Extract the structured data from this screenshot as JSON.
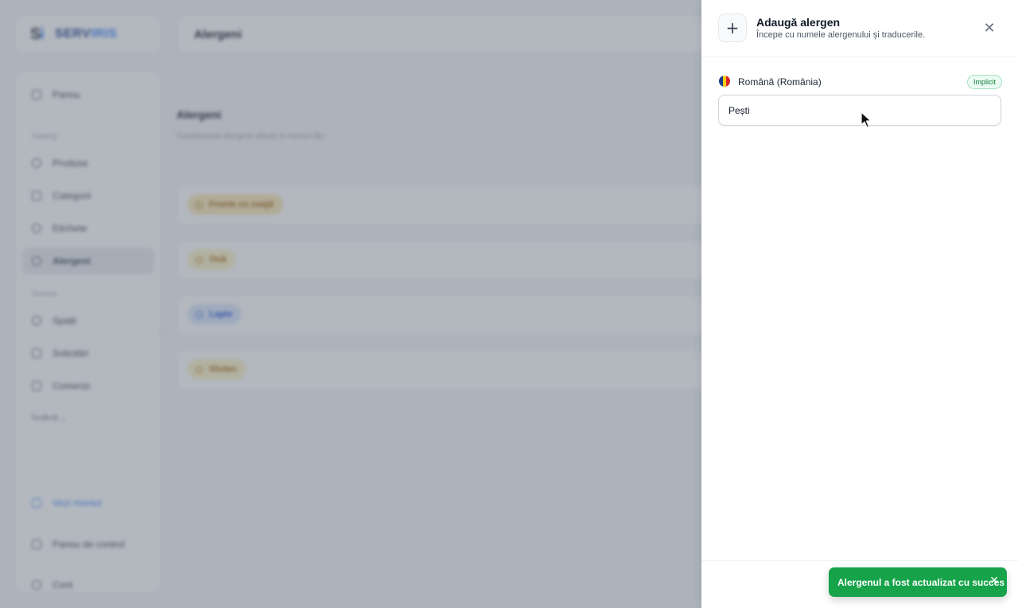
{
  "sidebar": {
    "logo_mark": "S",
    "logo_mark_accent": "i",
    "logo_text": "SERV",
    "logo_text_accent": "IRIS",
    "items": [
      {
        "label": "Panou",
        "icon": "grid-icon"
      },
      {
        "label": "Produse",
        "icon": "box-icon"
      },
      {
        "label": "Categorii",
        "icon": "grid-icon"
      },
      {
        "label": "Etichete",
        "icon": "tag-icon"
      },
      {
        "label": "Alergeni",
        "icon": "tag-icon"
      },
      {
        "label": "Spații",
        "icon": "pin-icon"
      },
      {
        "label": "Solicitări",
        "icon": "bell-icon"
      },
      {
        "label": "Comenzi",
        "icon": "receipt-icon"
      }
    ],
    "sections": {
      "catalog": "Catalog",
      "service": "Serviciu"
    },
    "more_label": "Încărcă",
    "view_menu": "Vezi meniul",
    "control_panel": "Panou de control",
    "account": "Cont"
  },
  "topbar": {
    "title": "Alergeni"
  },
  "main": {
    "title": "Alergeni",
    "subtitle": "Gestionează alergenii afișați în meniul tău",
    "allergens": [
      "Fructe cu coajă",
      "Ouă",
      "Lapte",
      "Gluten"
    ]
  },
  "drawer": {
    "title": "Adaugă alergen",
    "subtitle": "Începe cu numele alergenului și traducerile.",
    "language": "Română (România)",
    "default_badge": "Implicit",
    "name_value": "Pești"
  },
  "toast": {
    "message": "Alergenul a fost actualizat cu succes",
    "bg_color": "#16a34a"
  },
  "colors": {
    "accent": "#3b82f6",
    "success": "#16a34a"
  }
}
